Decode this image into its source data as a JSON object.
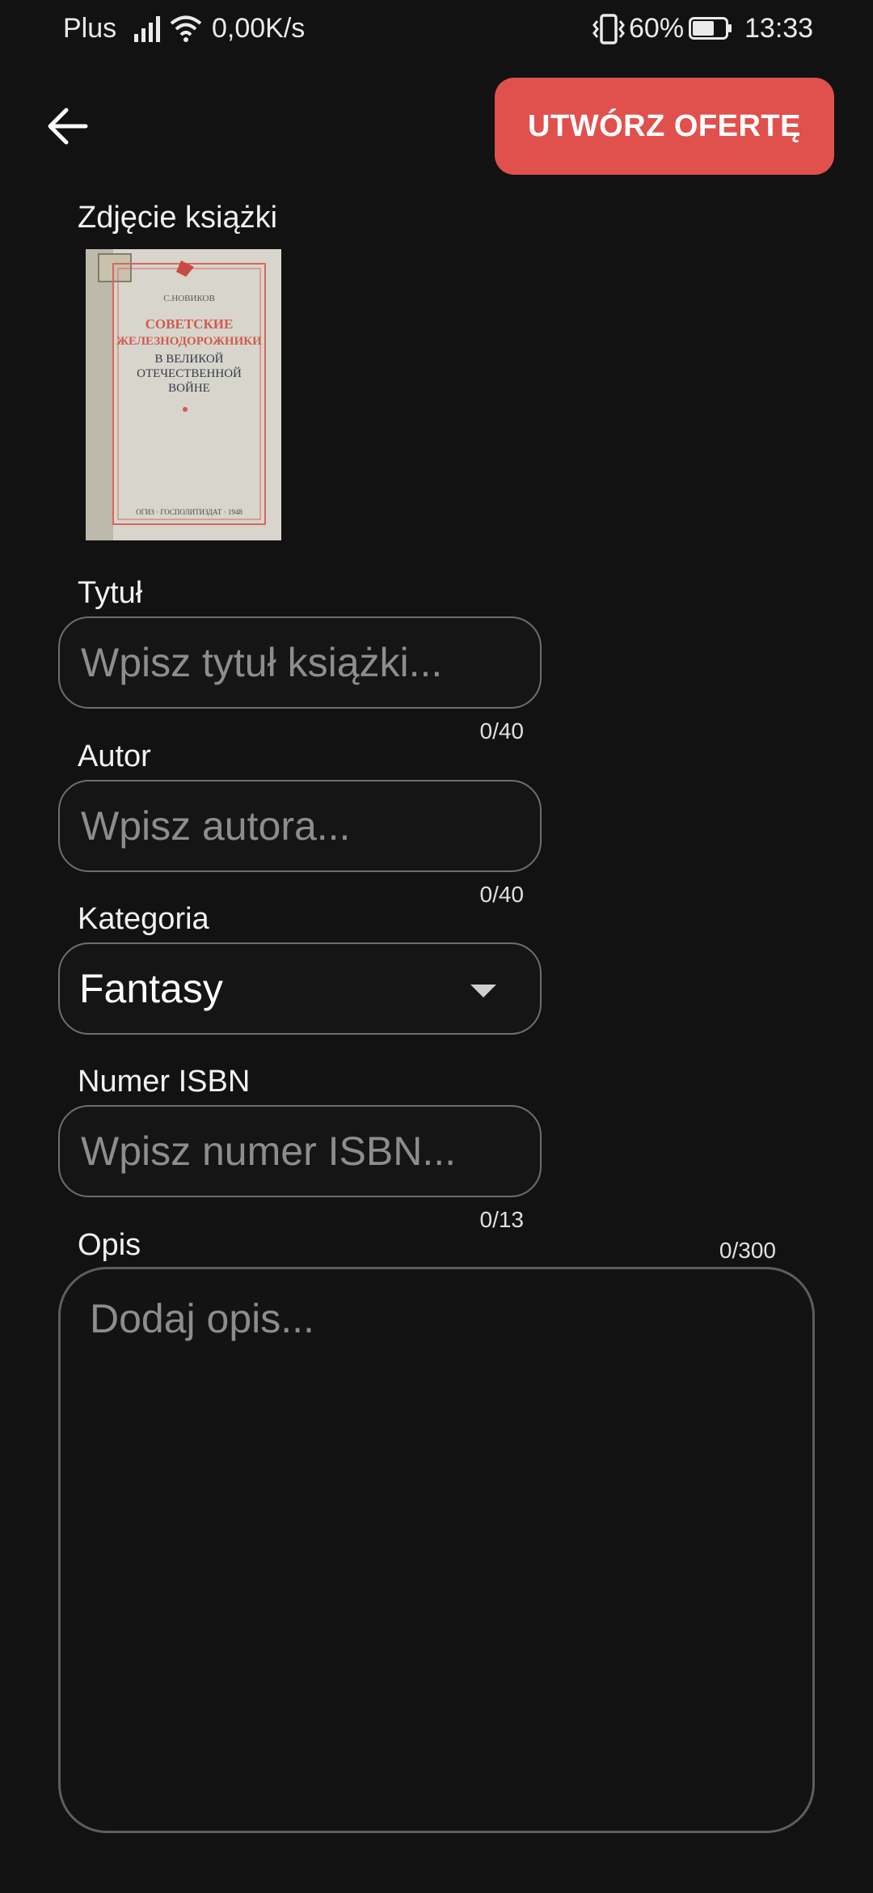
{
  "status_bar": {
    "carrier": "Plus",
    "speed": "0,00K/s",
    "battery": "60%",
    "time": "13:33"
  },
  "header": {
    "create_offer_label": "UTWÓRZ OFERTĘ"
  },
  "photo": {
    "label": "Zdjęcie książki",
    "book_cover": {
      "author": "С.НОВИКОВ",
      "title_red_1": "СОВЕТСКИЕ",
      "title_red_2": "ЖЕЛЕЗНОДОРОЖНИКИ",
      "title_dark_1": "В ВЕЛИКОЙ",
      "title_dark_2": "ОТЕЧЕСТВЕННОЙ",
      "title_dark_3": "ВОЙНЕ",
      "publisher": "ОГИЗ · ГОСПОЛИТИЗДАТ · 1948"
    }
  },
  "form": {
    "title": {
      "label": "Tytuł",
      "placeholder": "Wpisz tytuł książki...",
      "counter": "0/40"
    },
    "author": {
      "label": "Autor",
      "placeholder": "Wpisz autora...",
      "counter": "0/40"
    },
    "category": {
      "label": "Kategoria",
      "value": "Fantasy"
    },
    "isbn": {
      "label": "Numer ISBN",
      "placeholder": "Wpisz numer ISBN...",
      "counter": "0/13"
    },
    "description": {
      "label": "Opis",
      "placeholder": "Dodaj opis...",
      "counter": "0/300"
    }
  },
  "colors": {
    "background": "#121212",
    "accent": "#e0514d",
    "field_border": "#6e6e6e",
    "placeholder": "#8d8d8d"
  }
}
